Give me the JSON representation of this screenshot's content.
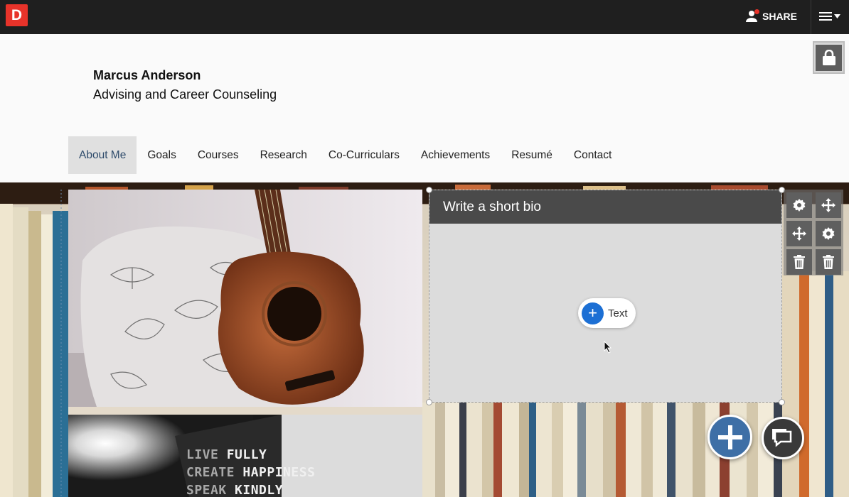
{
  "app": {
    "logo_letter": "D",
    "share_label": "SHARE"
  },
  "header": {
    "name": "Marcus Anderson",
    "subtitle": "Advising and Career Counseling"
  },
  "nav": {
    "items": [
      {
        "label": "About Me",
        "active": true
      },
      {
        "label": "Goals"
      },
      {
        "label": "Courses"
      },
      {
        "label": "Research"
      },
      {
        "label": "Co-Curriculars"
      },
      {
        "label": "Achievements"
      },
      {
        "label": "Resumé"
      },
      {
        "label": "Contact"
      }
    ]
  },
  "bio_block": {
    "title": "Write a short bio",
    "add_text_label": "Text"
  },
  "quote": {
    "line1a": "LIVE",
    "line1b": "FULLY",
    "line2a": "CREATE",
    "line2b": "HAPPINESS",
    "line3a": "SPEAK",
    "line3b": "KINDLY"
  },
  "colors": {
    "accent_red": "#e8332a",
    "primary_blue": "#1c6fd4",
    "fab_blue": "#3e6fa6",
    "topbar": "#1f1f1f"
  },
  "icons": [
    "person-icon",
    "hamburger-icon",
    "lock-icon",
    "gear-icon",
    "move-icon",
    "trash-icon",
    "plus-icon",
    "chat-icon",
    "cursor-icon"
  ]
}
